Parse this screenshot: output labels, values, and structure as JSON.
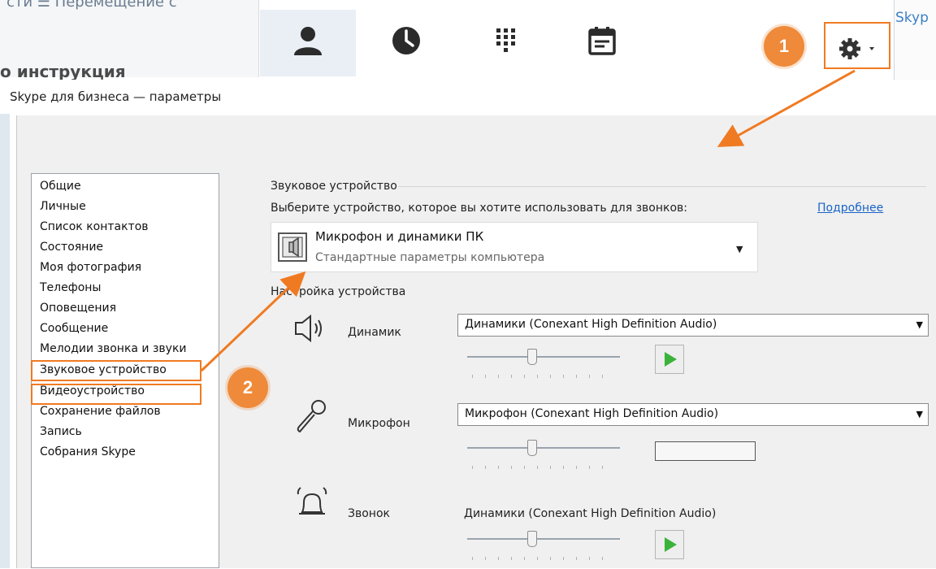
{
  "background_app": {
    "left_text_top": "сти   ☰ Перемещение с",
    "left_heading": "о инструкция",
    "toolbar_icons": [
      "contacts-icon",
      "history-icon",
      "dialpad-icon",
      "meetings-icon",
      "settings-icon"
    ],
    "skype_label": "Skyp"
  },
  "dialog": {
    "title": "Skype для бизнеса — параметры"
  },
  "categories": [
    "Общие",
    "Личные",
    "Список контактов",
    "Состояние",
    "Моя фотография",
    "Телефоны",
    "Оповещения",
    "Сообщение",
    "Мелодии звонка и звуки",
    "Звуковое устройство",
    "Видеоустройство",
    "Сохранение файлов",
    "Запись",
    "Собрания Skype"
  ],
  "audio_device": {
    "section_title": "Звуковое устройство",
    "prompt": "Выберите устройство, которое вы хотите использовать для звонков:",
    "more_link": "Подробнее",
    "selected_device": "Микрофон и динамики ПК",
    "selected_device_sub": "Стандартные параметры компьютера",
    "setup_title": "Настройка устройства",
    "speaker_label": "Динамик",
    "speaker_value": "Динамики (Conexant High Definition Audio)",
    "speaker_level": 0.42,
    "mic_label": "Микрофон",
    "mic_value": "Микрофон (Conexant High Definition Audio)",
    "mic_level": 0.42,
    "ringer_label": "Звонок",
    "ringer_value": "Динамики (Conexant High Definition Audio)",
    "ringer_level": 0.42
  },
  "annotations": {
    "marker1": "1",
    "marker2": "2",
    "color": "#f07a22"
  }
}
